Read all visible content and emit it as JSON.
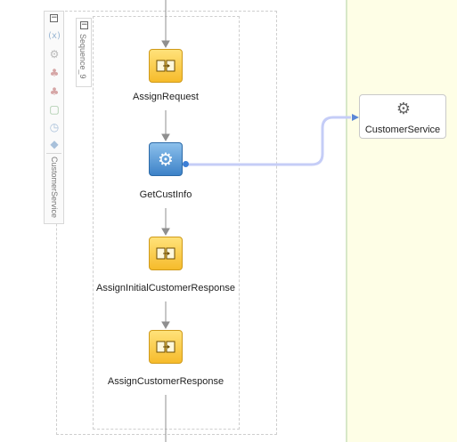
{
  "palette": {
    "collapse": "−",
    "variables_icon": "(x)",
    "lane_label": "CustomerService",
    "tools": [
      "gear-icon",
      "add-partner-icon",
      "add-partner-icon",
      "add-catch-icon",
      "add-timer-icon",
      "add-flow-icon"
    ]
  },
  "sequence": {
    "collapse": "−",
    "label": "Sequence_9"
  },
  "activities": [
    {
      "label": "AssignRequest",
      "kind": "assign"
    },
    {
      "label": "GetCustInfo",
      "kind": "invoke"
    },
    {
      "label": "AssignInitialCustomerResponse",
      "kind": "assign"
    },
    {
      "label": "AssignCustomerResponse",
      "kind": "assign"
    }
  ],
  "partner_link": {
    "label": "CustomerService",
    "icon": "gear-icon"
  },
  "colors": {
    "assign_fill": "#f6bb2b",
    "invoke_fill": "#3d82c8",
    "wire": "#c5cdf7",
    "right_pane": "#fefee6"
  }
}
